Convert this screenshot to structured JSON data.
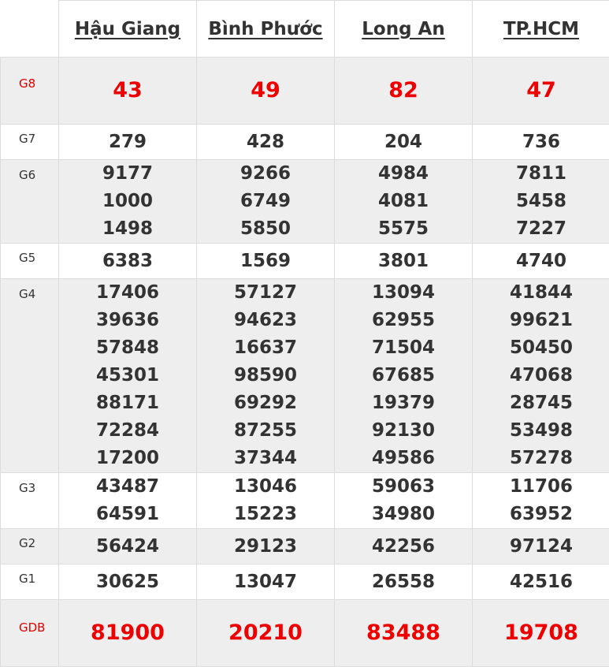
{
  "provinces": [
    "Hậu Giang",
    "Bình Phước",
    "Long An",
    "TP.HCM"
  ],
  "rows": [
    {
      "label": "G8",
      "red": true,
      "big": true,
      "shade": true,
      "values": [
        [
          "43"
        ],
        [
          "49"
        ],
        [
          "82"
        ],
        [
          "47"
        ]
      ]
    },
    {
      "label": "G7",
      "red": false,
      "big": false,
      "shade": false,
      "values": [
        [
          "279"
        ],
        [
          "428"
        ],
        [
          "204"
        ],
        [
          "736"
        ]
      ]
    },
    {
      "label": "G6",
      "red": false,
      "big": false,
      "shade": true,
      "values": [
        [
          "9177",
          "1000",
          "1498"
        ],
        [
          "9266",
          "6749",
          "5850"
        ],
        [
          "4984",
          "4081",
          "5575"
        ],
        [
          "7811",
          "5458",
          "7227"
        ]
      ]
    },
    {
      "label": "G5",
      "red": false,
      "big": false,
      "shade": false,
      "values": [
        [
          "6383"
        ],
        [
          "1569"
        ],
        [
          "3801"
        ],
        [
          "4740"
        ]
      ]
    },
    {
      "label": "G4",
      "red": false,
      "big": false,
      "shade": true,
      "values": [
        [
          "17406",
          "39636",
          "57848",
          "45301",
          "88171",
          "72284",
          "17200"
        ],
        [
          "57127",
          "94623",
          "16637",
          "98590",
          "69292",
          "87255",
          "37344"
        ],
        [
          "13094",
          "62955",
          "71504",
          "67685",
          "19379",
          "92130",
          "49586"
        ],
        [
          "41844",
          "99621",
          "50450",
          "47068",
          "28745",
          "53498",
          "57278"
        ]
      ]
    },
    {
      "label": "G3",
      "red": false,
      "big": false,
      "shade": false,
      "values": [
        [
          "43487",
          "64591"
        ],
        [
          "13046",
          "15223"
        ],
        [
          "59063",
          "34980"
        ],
        [
          "11706",
          "63952"
        ]
      ]
    },
    {
      "label": "G2",
      "red": false,
      "big": false,
      "shade": true,
      "values": [
        [
          "56424"
        ],
        [
          "29123"
        ],
        [
          "42256"
        ],
        [
          "97124"
        ]
      ]
    },
    {
      "label": "G1",
      "red": false,
      "big": false,
      "shade": false,
      "values": [
        [
          "30625"
        ],
        [
          "13047"
        ],
        [
          "26558"
        ],
        [
          "42516"
        ]
      ]
    },
    {
      "label": "GDB",
      "red": true,
      "big": true,
      "shade": true,
      "values": [
        [
          "81900"
        ],
        [
          "20210"
        ],
        [
          "83488"
        ],
        [
          "19708"
        ]
      ]
    }
  ],
  "colors": {
    "prize_red": "#dd0000",
    "jackpot_red": "#ee0000",
    "text": "#333333",
    "shade": "#eeeeee",
    "border": "#dcdcdc"
  }
}
